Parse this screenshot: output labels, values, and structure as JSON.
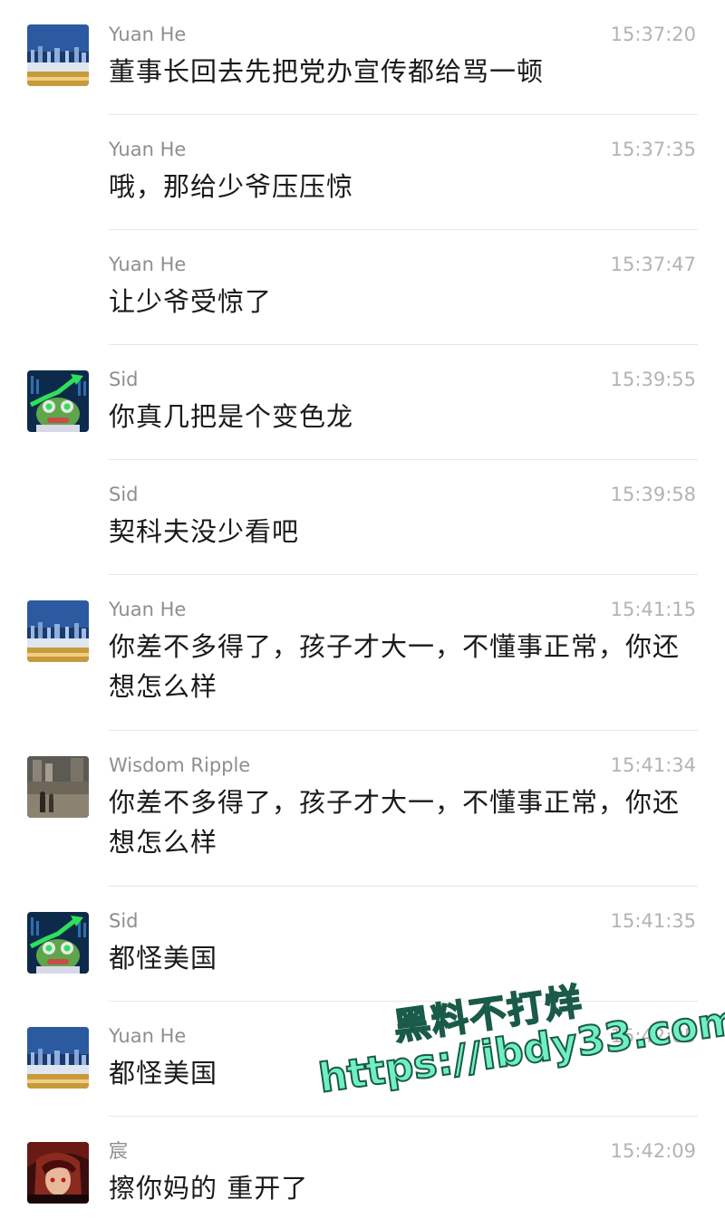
{
  "messages": [
    {
      "sender": "Yuan He",
      "time": "15:37:20",
      "text": "董事长回去先把党办宣传都给骂一顿",
      "avatar": "city-night"
    },
    {
      "sender": "Yuan He",
      "time": "15:37:35",
      "text": "哦，那给少爷压压惊",
      "avatar": ""
    },
    {
      "sender": "Yuan He",
      "time": "15:37:47",
      "text": "让少爷受惊了",
      "avatar": ""
    },
    {
      "sender": "Sid",
      "time": "15:39:55",
      "text": "你真几把是个变色龙",
      "avatar": "frog-stocks"
    },
    {
      "sender": "Sid",
      "time": "15:39:58",
      "text": "契科夫没少看吧",
      "avatar": ""
    },
    {
      "sender": "Yuan He",
      "time": "15:41:15",
      "text": "你差不多得了，孩子才大一，不懂事正常，你还想怎么样",
      "avatar": "city-night"
    },
    {
      "sender": "Wisdom Ripple",
      "time": "15:41:34",
      "text": "你差不多得了，孩子才大一，不懂事正常，你还想怎么样",
      "avatar": "street-photo"
    },
    {
      "sender": "Sid",
      "time": "15:41:35",
      "text": "都怪美国",
      "avatar": "frog-stocks"
    },
    {
      "sender": "Yuan He",
      "time": "15:42:05",
      "text": "都怪美国",
      "avatar": "city-night"
    },
    {
      "sender": "宸",
      "time": "15:42:09",
      "text": "擦你妈的 重开了",
      "avatar": "anime-character"
    }
  ],
  "watermark": {
    "line1": "黑料不打烊",
    "line2": "https://ibdy33.com"
  }
}
